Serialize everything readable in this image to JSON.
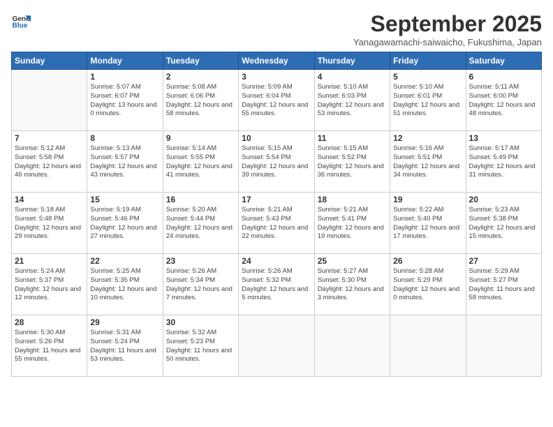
{
  "logo": {
    "line1": "General",
    "line2": "Blue"
  },
  "title": "September 2025",
  "subtitle": "Yanagawamachi-saiwaicho, Fukushima, Japan",
  "weekdays": [
    "Sunday",
    "Monday",
    "Tuesday",
    "Wednesday",
    "Thursday",
    "Friday",
    "Saturday"
  ],
  "weeks": [
    [
      {
        "day": "",
        "sunrise": "",
        "sunset": "",
        "daylight": ""
      },
      {
        "day": "1",
        "sunrise": "5:07 AM",
        "sunset": "6:07 PM",
        "daylight": "13 hours and 0 minutes."
      },
      {
        "day": "2",
        "sunrise": "5:08 AM",
        "sunset": "6:06 PM",
        "daylight": "12 hours and 58 minutes."
      },
      {
        "day": "3",
        "sunrise": "5:09 AM",
        "sunset": "6:04 PM",
        "daylight": "12 hours and 55 minutes."
      },
      {
        "day": "4",
        "sunrise": "5:10 AM",
        "sunset": "6:03 PM",
        "daylight": "12 hours and 53 minutes."
      },
      {
        "day": "5",
        "sunrise": "5:10 AM",
        "sunset": "6:01 PM",
        "daylight": "12 hours and 51 minutes."
      },
      {
        "day": "6",
        "sunrise": "5:11 AM",
        "sunset": "6:00 PM",
        "daylight": "12 hours and 48 minutes."
      }
    ],
    [
      {
        "day": "7",
        "sunrise": "5:12 AM",
        "sunset": "5:58 PM",
        "daylight": "12 hours and 46 minutes."
      },
      {
        "day": "8",
        "sunrise": "5:13 AM",
        "sunset": "5:57 PM",
        "daylight": "12 hours and 43 minutes."
      },
      {
        "day": "9",
        "sunrise": "5:14 AM",
        "sunset": "5:55 PM",
        "daylight": "12 hours and 41 minutes."
      },
      {
        "day": "10",
        "sunrise": "5:15 AM",
        "sunset": "5:54 PM",
        "daylight": "12 hours and 39 minutes."
      },
      {
        "day": "11",
        "sunrise": "5:15 AM",
        "sunset": "5:52 PM",
        "daylight": "12 hours and 36 minutes."
      },
      {
        "day": "12",
        "sunrise": "5:16 AM",
        "sunset": "5:51 PM",
        "daylight": "12 hours and 34 minutes."
      },
      {
        "day": "13",
        "sunrise": "5:17 AM",
        "sunset": "5:49 PM",
        "daylight": "12 hours and 31 minutes."
      }
    ],
    [
      {
        "day": "14",
        "sunrise": "5:18 AM",
        "sunset": "5:48 PM",
        "daylight": "12 hours and 29 minutes."
      },
      {
        "day": "15",
        "sunrise": "5:19 AM",
        "sunset": "5:46 PM",
        "daylight": "12 hours and 27 minutes."
      },
      {
        "day": "16",
        "sunrise": "5:20 AM",
        "sunset": "5:44 PM",
        "daylight": "12 hours and 24 minutes."
      },
      {
        "day": "17",
        "sunrise": "5:21 AM",
        "sunset": "5:43 PM",
        "daylight": "12 hours and 22 minutes."
      },
      {
        "day": "18",
        "sunrise": "5:21 AM",
        "sunset": "5:41 PM",
        "daylight": "12 hours and 19 minutes."
      },
      {
        "day": "19",
        "sunrise": "5:22 AM",
        "sunset": "5:40 PM",
        "daylight": "12 hours and 17 minutes."
      },
      {
        "day": "20",
        "sunrise": "5:23 AM",
        "sunset": "5:38 PM",
        "daylight": "12 hours and 15 minutes."
      }
    ],
    [
      {
        "day": "21",
        "sunrise": "5:24 AM",
        "sunset": "5:37 PM",
        "daylight": "12 hours and 12 minutes."
      },
      {
        "day": "22",
        "sunrise": "5:25 AM",
        "sunset": "5:35 PM",
        "daylight": "12 hours and 10 minutes."
      },
      {
        "day": "23",
        "sunrise": "5:26 AM",
        "sunset": "5:34 PM",
        "daylight": "12 hours and 7 minutes."
      },
      {
        "day": "24",
        "sunrise": "5:26 AM",
        "sunset": "5:32 PM",
        "daylight": "12 hours and 5 minutes."
      },
      {
        "day": "25",
        "sunrise": "5:27 AM",
        "sunset": "5:30 PM",
        "daylight": "12 hours and 3 minutes."
      },
      {
        "day": "26",
        "sunrise": "5:28 AM",
        "sunset": "5:29 PM",
        "daylight": "12 hours and 0 minutes."
      },
      {
        "day": "27",
        "sunrise": "5:29 AM",
        "sunset": "5:27 PM",
        "daylight": "11 hours and 58 minutes."
      }
    ],
    [
      {
        "day": "28",
        "sunrise": "5:30 AM",
        "sunset": "5:26 PM",
        "daylight": "11 hours and 55 minutes."
      },
      {
        "day": "29",
        "sunrise": "5:31 AM",
        "sunset": "5:24 PM",
        "daylight": "11 hours and 53 minutes."
      },
      {
        "day": "30",
        "sunrise": "5:32 AM",
        "sunset": "5:23 PM",
        "daylight": "11 hours and 50 minutes."
      },
      {
        "day": "",
        "sunrise": "",
        "sunset": "",
        "daylight": ""
      },
      {
        "day": "",
        "sunrise": "",
        "sunset": "",
        "daylight": ""
      },
      {
        "day": "",
        "sunrise": "",
        "sunset": "",
        "daylight": ""
      },
      {
        "day": "",
        "sunrise": "",
        "sunset": "",
        "daylight": ""
      }
    ]
  ]
}
